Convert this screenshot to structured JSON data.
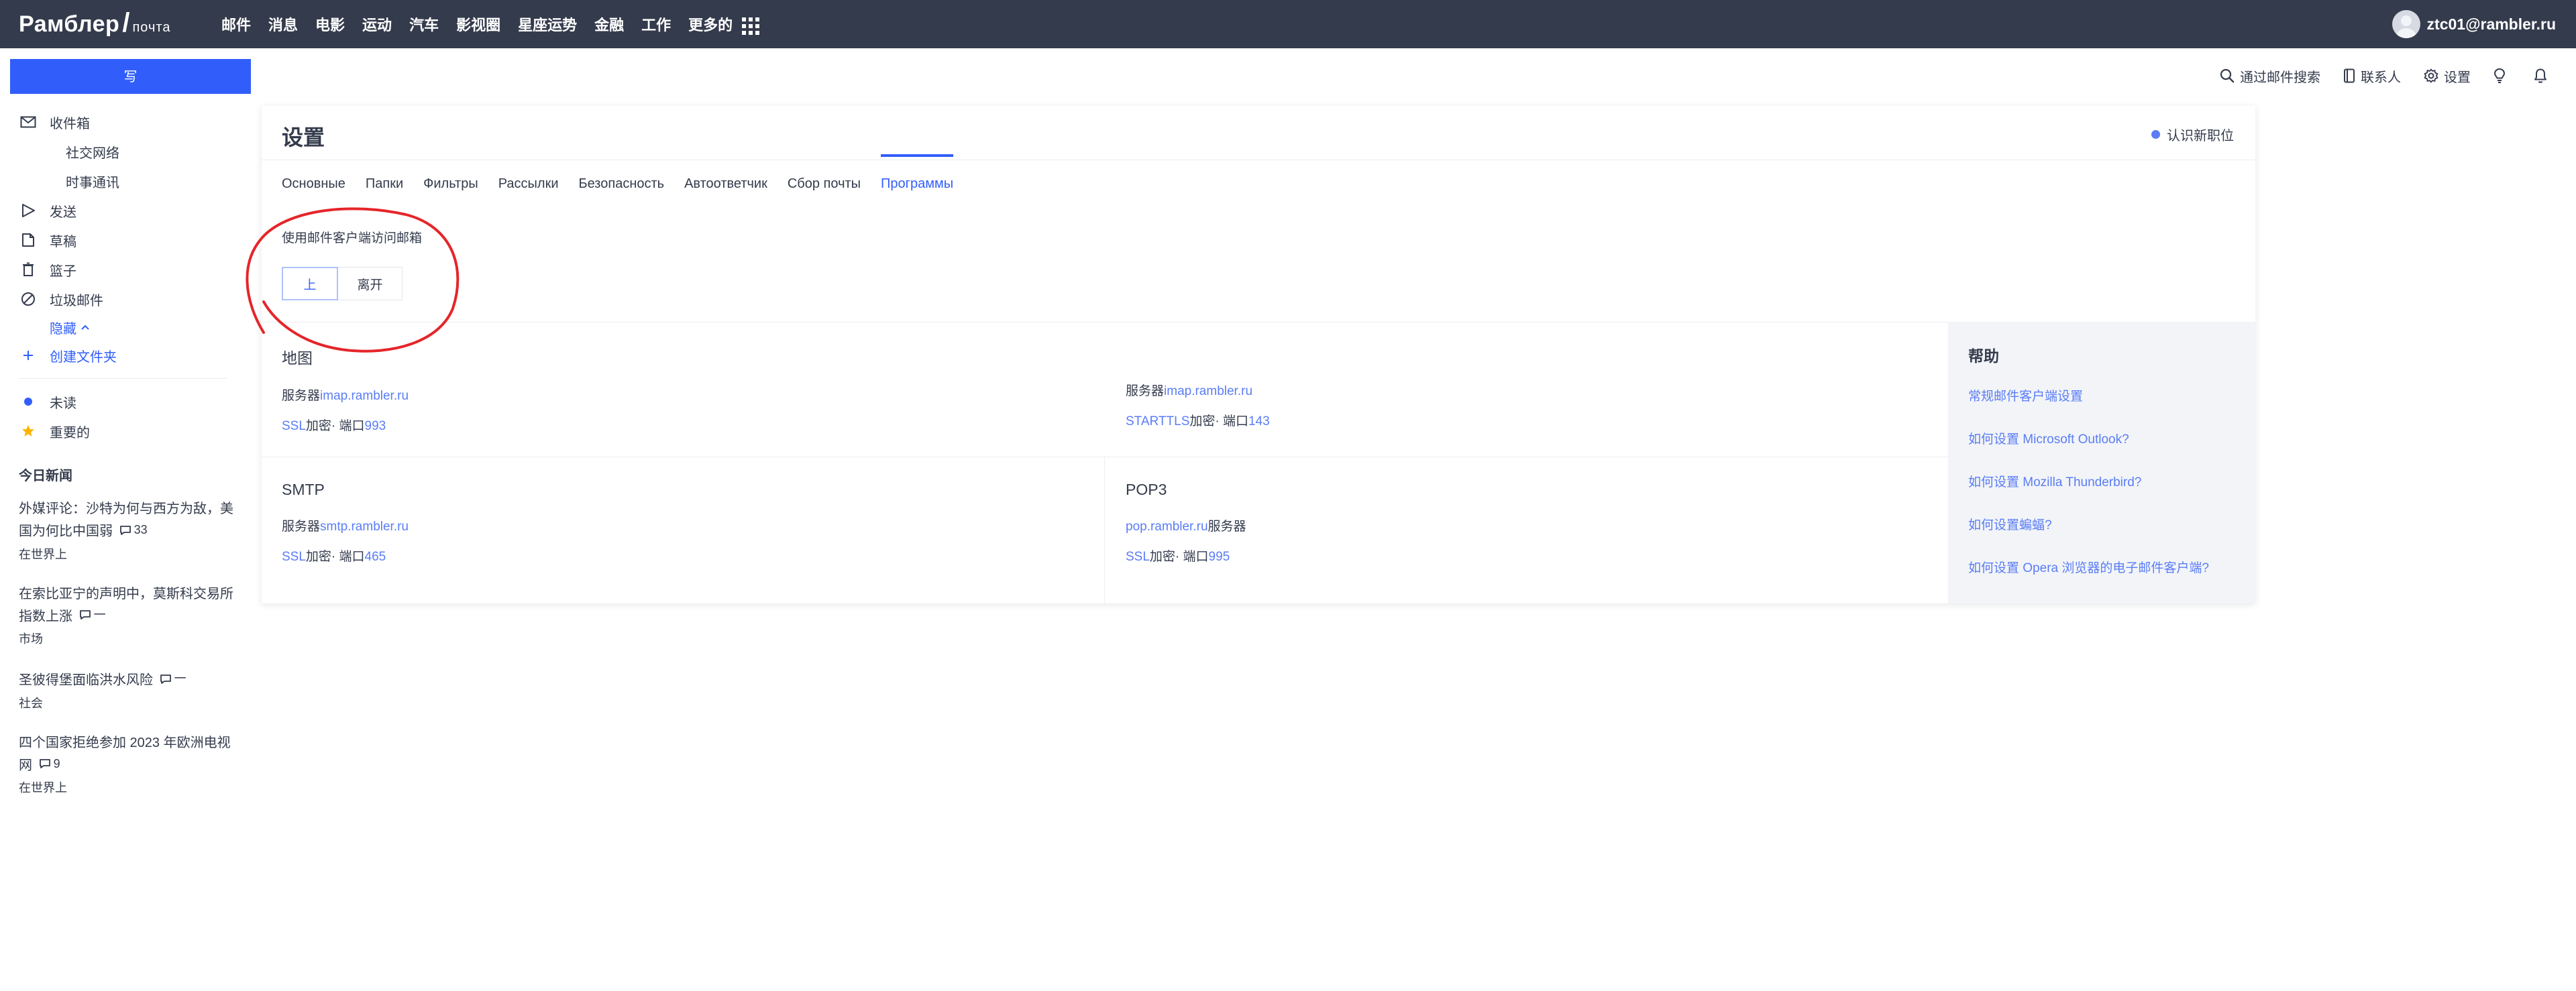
{
  "topbar": {
    "logo_main": "Рамблер",
    "logo_sub": "почта",
    "nav": [
      "邮件",
      "消息",
      "电影",
      "运动",
      "汽车",
      "影视圈",
      "星座运势",
      "金融",
      "工作",
      "更多的"
    ],
    "user_email": "ztc01@rambler.ru"
  },
  "compose_label": "写",
  "toolbar": {
    "search": "通过邮件搜索",
    "contacts": "联系人",
    "settings": "设置"
  },
  "sidebar": {
    "inbox": "收件箱",
    "social": "社交网络",
    "newsletters": "时事通讯",
    "sent": "发送",
    "drafts": "草稿",
    "trash": "篮子",
    "spam": "垃圾邮件",
    "hide": "隐藏",
    "create_folder": "创建文件夹",
    "unread": "未读",
    "important": "重要的"
  },
  "news": {
    "title": "今日新闻",
    "items": [
      {
        "line1": "外媒评论：沙特为何与西方为敌，美",
        "line2": "国为何比中国弱",
        "comments": "33",
        "category": "在世界上"
      },
      {
        "line1": "在索比亚宁的声明中，莫斯科交易所",
        "line2": "指数上涨",
        "comments": "一",
        "category": "市场"
      },
      {
        "line1": "圣彼得堡面临洪水风险",
        "line2": "",
        "comments": "一",
        "category": "社会"
      },
      {
        "line1": "四个国家拒绝参加 2023 年欧洲电视",
        "line2": "网",
        "comments": "9",
        "category": "在世界上"
      }
    ]
  },
  "settings": {
    "title": "设置",
    "whats_new": "认识新职位",
    "tabs": [
      "Основные",
      "Папки",
      "Фильтры",
      "Рассылки",
      "Безопасность",
      "Автоответчик",
      "Сбор почты",
      "Программы"
    ],
    "active_tab": "Программы",
    "client_label": "使用邮件客户端访问邮箱",
    "toggle_on": "上",
    "toggle_off": "离开",
    "imap": {
      "name": "地图",
      "server_prefix": "服务器",
      "server": "imap.rambler.ru",
      "ssl": "SSL",
      "enc": "加密· 端口",
      "port": "993"
    },
    "imap2": {
      "server_prefix": "服务器",
      "server": "imap.rambler.ru",
      "ssl": "STARTTLS",
      "enc": "加密· 端口",
      "port": "143"
    },
    "smtp": {
      "name": "SMTP",
      "server_prefix": "服务器",
      "server": "smtp.rambler.ru",
      "ssl": "SSL",
      "enc": "加密· 端口",
      "port": "465"
    },
    "pop3": {
      "name": "POP3",
      "server": "pop.rambler.ru",
      "server_suffix": "服务器",
      "ssl": "SSL",
      "enc": "加密· 端口",
      "port": "995"
    },
    "help": {
      "title": "帮助",
      "links": [
        "常规邮件客户端设置",
        "如何设置 Microsoft Outlook?",
        "如何设置 Mozilla Thunderbird?",
        "如何设置蝙蝠?",
        "如何设置 Opera 浏览器的电子邮件客户端?"
      ]
    }
  },
  "colors": {
    "topbar": "#343b4c",
    "accent": "#315efb",
    "link": "#5a7df5",
    "annotation": "#e5252a"
  }
}
